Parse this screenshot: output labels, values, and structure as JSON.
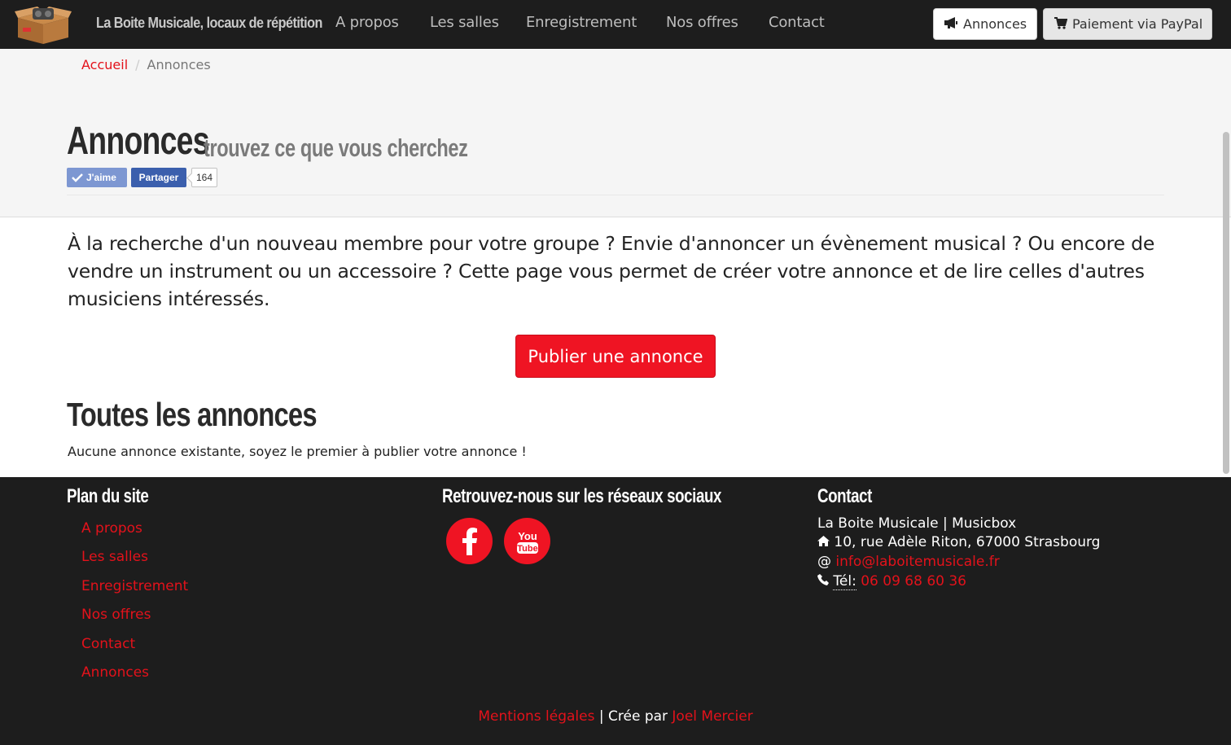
{
  "navbar": {
    "brand": "La Boite Musicale, locaux de répétition",
    "links": [
      "A propos",
      "Les salles",
      "Enregistrement",
      "Nos offres",
      "Contact"
    ],
    "annonces_button": "Annonces",
    "paypal_button": "Paiement via PayPal"
  },
  "breadcrumb": {
    "home": "Accueil",
    "separator": "/",
    "current": "Annonces"
  },
  "header": {
    "title": "Annonces",
    "subtitle": "trouvez ce que vous cherchez"
  },
  "facebook": {
    "like": "J'aime",
    "share": "Partager",
    "count": "164"
  },
  "main": {
    "intro": "À la recherche d'un nouveau membre pour votre groupe ? Envie d'annoncer un évènement musical ? Ou encore de vendre un instrument ou un accessoire ? Cette page vous permet de créer votre annonce et de lire celles d'autres musiciens intéressés.",
    "publish_button": "Publier une annonce",
    "section_title": "Toutes les annonces",
    "empty_message": "Aucune annonce existante, soyez le premier à publier votre annonce !"
  },
  "footer": {
    "sitemap_title": "Plan du site",
    "sitemap_links": [
      "A propos",
      "Les salles",
      "Enregistrement",
      "Nos offres",
      "Contact",
      "Annonces"
    ],
    "social_title": "Retrouvez-nous sur les réseaux sociaux",
    "contact_title": "Contact",
    "company": "La Boite Musicale | Musicbox",
    "address": "10, rue Adèle Riton, 67000 Strasbourg",
    "email_prefix": "@",
    "email": "info@laboitemusicale.fr",
    "phone_label": "Tél:",
    "phone": "06 09 68 60 36",
    "legal": "Mentions légales",
    "created_by_prefix": "| Crée par",
    "author": "Joel Mercier"
  },
  "colors": {
    "accent": "#e3121b",
    "button_red": "#ef1423",
    "dark": "#1d1d1d",
    "header_bg": "#f5f5f5",
    "facebook_blue": "#3b5fad"
  }
}
